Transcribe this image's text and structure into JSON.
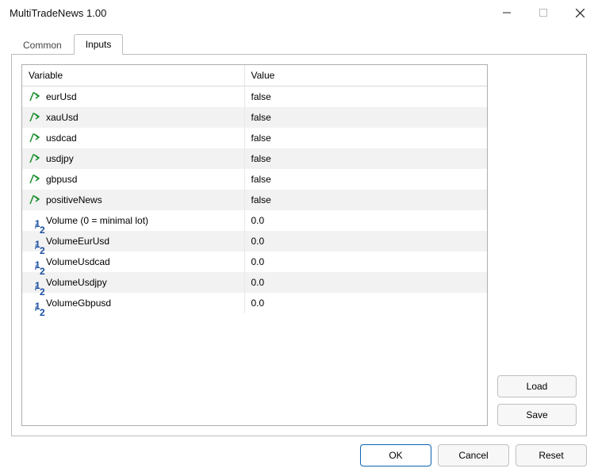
{
  "window": {
    "title": "MultiTradeNews 1.00"
  },
  "tabs": {
    "common": "Common",
    "inputs": "Inputs"
  },
  "grid": {
    "headers": {
      "variable": "Variable",
      "value": "Value"
    },
    "rows": [
      {
        "icon": "bool",
        "name": "eurUsd",
        "value": "false"
      },
      {
        "icon": "bool",
        "name": "xauUsd",
        "value": "false"
      },
      {
        "icon": "bool",
        "name": "usdcad",
        "value": "false"
      },
      {
        "icon": "bool",
        "name": "usdjpy",
        "value": "false"
      },
      {
        "icon": "bool",
        "name": "gbpusd",
        "value": "false"
      },
      {
        "icon": "bool",
        "name": "positiveNews",
        "value": "false"
      },
      {
        "icon": "num",
        "name": "Volume (0 = minimal lot)",
        "value": "0.0"
      },
      {
        "icon": "num",
        "name": "VolumeEurUsd",
        "value": "0.0"
      },
      {
        "icon": "num",
        "name": "VolumeUsdcad",
        "value": "0.0"
      },
      {
        "icon": "num",
        "name": "VolumeUsdjpy",
        "value": "0.0"
      },
      {
        "icon": "num",
        "name": "VolumeGbpusd",
        "value": "0.0"
      }
    ]
  },
  "buttons": {
    "load": "Load",
    "save": "Save",
    "ok": "OK",
    "cancel": "Cancel",
    "reset": "Reset"
  }
}
